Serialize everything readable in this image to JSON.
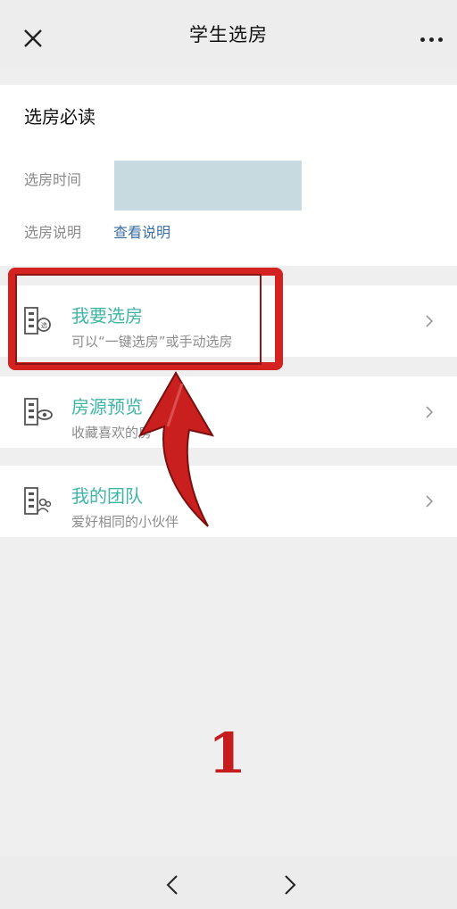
{
  "header": {
    "title": "学生选房",
    "close_icon": "close-icon",
    "more_icon": "more-dots-icon"
  },
  "notice": {
    "heading": "选房必读",
    "time_label": "选房时间",
    "desc_label": "选房说明",
    "desc_link": "查看说明"
  },
  "menu": [
    {
      "title": "我要选房",
      "subtitle": "可以“一键选房”或手动选房",
      "icon": "building-select-icon"
    },
    {
      "title": "房源预览",
      "subtitle": "收藏喜欢的房",
      "icon": "building-view-icon"
    },
    {
      "title": "我的团队",
      "subtitle": "爱好相同的小伙伴",
      "icon": "building-team-icon"
    }
  ],
  "annotation": {
    "step_number": "1",
    "color": "#d42221"
  },
  "bottom_nav": {
    "back_icon": "chevron-left-icon",
    "forward_icon": "chevron-right-icon"
  },
  "colors": {
    "accent": "#3fb5a6",
    "link": "#3d6fa4",
    "annotation_red": "#d42221"
  }
}
